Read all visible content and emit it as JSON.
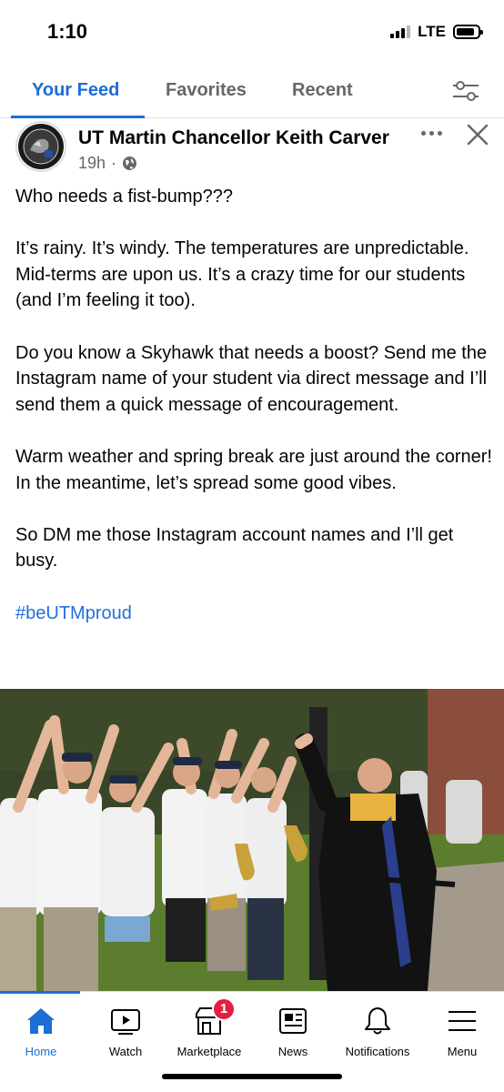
{
  "status_bar": {
    "time": "1:10",
    "network": "LTE",
    "signal_bars_active": 3,
    "signal_bars_total": 4,
    "battery_level_percent": 85
  },
  "feed_tabs": {
    "tabs": [
      {
        "label": "Your Feed",
        "active": true
      },
      {
        "label": "Favorites",
        "active": false
      },
      {
        "label": "Recent",
        "active": false
      }
    ],
    "filter_icon": "sliders-icon"
  },
  "post": {
    "author": "UT Martin Chancellor Keith Carver",
    "time_ago": "19h",
    "separator": "·",
    "privacy_icon": "globe-icon",
    "paragraphs": [
      "Who needs a fist-bump???",
      "It’s rainy. It’s windy. The temperatures are unpredictable. Mid-terms are upon us. It’s a crazy time for our students (and I’m feeling it too).",
      "Do you know a Skyhawk that needs a boost? Send me the Instagram name of your student via direct message and I’ll send them a quick message of encouragement.",
      "Warm weather and spring break are just around the corner! In the meantime, let’s spread some good vibes.",
      "So DM me those Instagram account names and I’ll get busy."
    ],
    "hashtag": "#beUTMproud",
    "photo_description_icon": "photo-image"
  },
  "bottom_nav": {
    "items": [
      {
        "label": "Home",
        "icon": "home-icon",
        "active": true
      },
      {
        "label": "Watch",
        "icon": "video-icon",
        "active": false
      },
      {
        "label": "Marketplace",
        "icon": "marketplace-icon",
        "active": false,
        "badge": "1"
      },
      {
        "label": "News",
        "icon": "news-icon",
        "active": false
      },
      {
        "label": "Notifications",
        "icon": "bell-icon",
        "active": false
      },
      {
        "label": "Menu",
        "icon": "menu-icon",
        "active": false
      }
    ]
  },
  "colors": {
    "accent": "#1b6ed6",
    "hashtag": "#216fdb",
    "secondary_text": "#65676b",
    "badge": "#e41e3f"
  }
}
